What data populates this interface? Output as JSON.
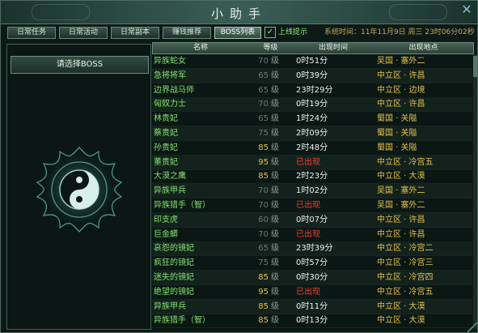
{
  "window": {
    "title": "小助手",
    "close_icon": "close-icon"
  },
  "tabs": [
    {
      "label": "日常任务",
      "active": false
    },
    {
      "label": "日常活动",
      "active": false
    },
    {
      "label": "日常副本",
      "active": false
    },
    {
      "label": "赚钱推荐",
      "active": false
    },
    {
      "label": "BOSS列表",
      "active": true
    }
  ],
  "online_tip": {
    "label": "上线提示",
    "checked": true
  },
  "system_time": "系统时间：11年11月9日 周三 23时06分02秒",
  "left": {
    "select_button": "请选择BOSS",
    "emblem_icon": "yin-yang-emblem-icon"
  },
  "table": {
    "headers": [
      "名称",
      "等级",
      "出现时间",
      "出现地点"
    ],
    "level_unit": "级",
    "rows": [
      {
        "name": "异族蛇女",
        "level": "70",
        "time": "0时51分",
        "location": "吴国 · 塞外二"
      },
      {
        "name": "急将将军",
        "level": "65",
        "time": "0时39分",
        "location": "中立区 · 许昌"
      },
      {
        "name": "边界战马师",
        "level": "65",
        "time": "23时29分",
        "location": "中立区 · 边境"
      },
      {
        "name": "匈奴力士",
        "level": "70",
        "time": "0时19分",
        "location": "中立区 · 许昌"
      },
      {
        "name": "林贵妃",
        "level": "65",
        "time": "1时24分",
        "location": "蜀国 · 关隘"
      },
      {
        "name": "蔡贵妃",
        "level": "75",
        "time": "2时09分",
        "location": "蜀国 · 关隘"
      },
      {
        "name": "孙贵妃",
        "level": "85",
        "time": "2时48分",
        "location": "蜀国 · 关隘"
      },
      {
        "name": "董贵妃",
        "level": "95",
        "time": "已出现",
        "location": "中立区 · 冷宫五"
      },
      {
        "name": "大漠之鹰",
        "level": "85",
        "time": "2时23分",
        "location": "中立区 · 大漠"
      },
      {
        "name": "异族甲兵",
        "level": "70",
        "time": "1时02分",
        "location": "吴国 · 塞外二"
      },
      {
        "name": "异族猎手（智）",
        "level": "70",
        "time": "已出现",
        "location": "吴国 · 塞外二"
      },
      {
        "name": "印支虎",
        "level": "60",
        "time": "0时07分",
        "location": "中立区 · 许昌"
      },
      {
        "name": "巨金蟒",
        "level": "70",
        "time": "已出现",
        "location": "中立区 · 许昌"
      },
      {
        "name": "哀怨的镜妃",
        "level": "65",
        "time": "23时39分",
        "location": "中立区 · 冷宫二"
      },
      {
        "name": "疯狂的镜妃",
        "level": "75",
        "time": "0时57分",
        "location": "中立区 · 冷宫三"
      },
      {
        "name": "迷失的镜妃",
        "level": "85",
        "time": "0时30分",
        "location": "中立区 · 冷宫四"
      },
      {
        "name": "绝望的镜妃",
        "level": "95",
        "time": "已出现",
        "location": "中立区 · 冷宫五"
      },
      {
        "name": "异族甲兵",
        "level": "85",
        "time": "0时11分",
        "location": "中立区 · 大漠"
      },
      {
        "name": "异族猎手（智）",
        "level": "85",
        "time": "0时13分",
        "location": "中立区 · 大漠"
      }
    ]
  }
}
